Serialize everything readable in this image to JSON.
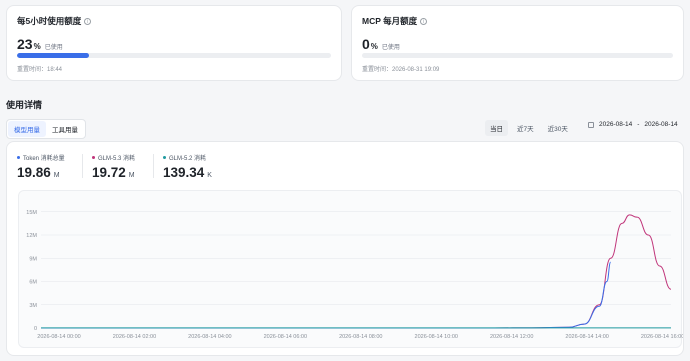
{
  "quota_5h": {
    "title": "每5小时使用额度",
    "percent": "23",
    "percent_unit": "%",
    "used_label": "已使用",
    "progress": 0.23,
    "reset_text": "重置时间：18:44"
  },
  "quota_mcp": {
    "title": "MCP 每月额度",
    "percent": "0",
    "percent_unit": "%",
    "used_label": "已使用",
    "progress": 0,
    "reset_text": "重置时间：2026-08-31 19:09"
  },
  "details": {
    "title": "使用详情",
    "tabs": [
      "模型用量",
      "工具用量"
    ],
    "active_tab": 0,
    "ranges": [
      "当日",
      "近7天",
      "近30天"
    ],
    "active_range": 0,
    "date_start": "2026-08-14",
    "date_sep": "-",
    "date_end": "2026-08-14"
  },
  "metrics": [
    {
      "label": "Token 消耗总量",
      "value": "19.86",
      "unit": "M",
      "color": "#3a6ee8"
    },
    {
      "label": "GLM-5.3 消耗",
      "value": "19.72",
      "unit": "M",
      "color": "#c0357a"
    },
    {
      "label": "GLM-5.2 消耗",
      "value": "139.34",
      "unit": "K",
      "color": "#1f9aa0"
    }
  ],
  "chart_data": {
    "type": "line",
    "x_labels": [
      "2026-08-14 00:00",
      "2026-08-14 02:00",
      "2026-08-14 04:00",
      "2026-08-14 06:00",
      "2026-08-14 08:00",
      "2026-08-14 10:00",
      "2026-08-14 12:00",
      "2026-08-14 14:00",
      "2026-08-14 16:00"
    ],
    "x_range": [
      0,
      16.7
    ],
    "y_ticks": [
      0,
      3,
      6,
      9,
      12,
      15
    ],
    "y_tick_labels": [
      "0",
      "3M",
      "6M",
      "9M",
      "12M",
      "15M"
    ],
    "ylim": [
      0,
      16
    ],
    "series": [
      {
        "color": "#c0357a",
        "points": [
          [
            0,
            0
          ],
          [
            12,
            0
          ],
          [
            13,
            0.02
          ],
          [
            14,
            0.1
          ],
          [
            14.4,
            0.5
          ],
          [
            14.8,
            3
          ],
          [
            15.1,
            9
          ],
          [
            15.4,
            13.5
          ],
          [
            15.6,
            14.6
          ],
          [
            15.8,
            14.3
          ],
          [
            16.1,
            12
          ],
          [
            16.4,
            8
          ],
          [
            16.7,
            5
          ]
        ]
      },
      {
        "color": "#3a6ee8",
        "points": [
          [
            0,
            0
          ],
          [
            12,
            0
          ],
          [
            13,
            0.02
          ],
          [
            14,
            0.1
          ],
          [
            14.4,
            0.5
          ],
          [
            14.8,
            2.8
          ],
          [
            15.0,
            6
          ],
          [
            15.1,
            8.5
          ]
        ]
      },
      {
        "color": "#1f9aa0",
        "points": [
          [
            0,
            0.02
          ],
          [
            16.7,
            0.02
          ]
        ]
      }
    ]
  }
}
